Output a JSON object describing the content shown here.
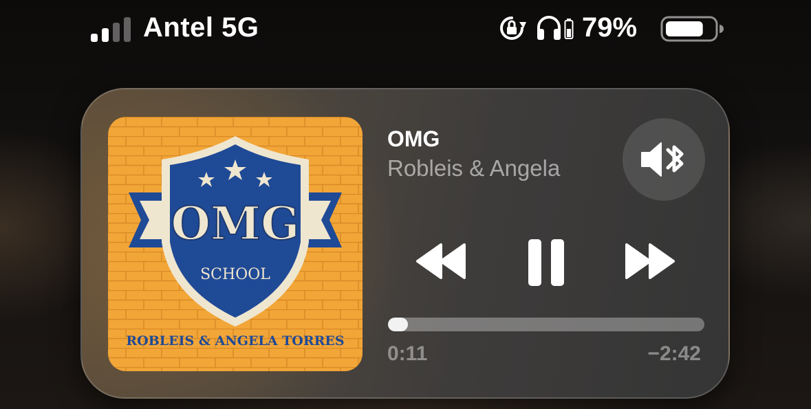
{
  "status_bar": {
    "carrier": "Antel 5G",
    "signal_bars_active": 2,
    "signal_bars_total": 4,
    "battery_percent_label": "79%",
    "battery_level": 0.79,
    "icons": [
      "signal-icon",
      "rotation-lock-icon",
      "headphones-icon",
      "headphones-battery-icon",
      "battery-icon"
    ]
  },
  "now_playing": {
    "title": "OMG",
    "artist": "Robleis & Angela",
    "artwork": {
      "logo_text": "OMG",
      "school_text": "SCHOOL",
      "footer_text": "ROBLEIS & ANGELA TORRES"
    },
    "output_icon": "speaker-bluetooth-icon",
    "controls": {
      "rewind": "rewind-icon",
      "pause": "pause-icon",
      "fast_forward": "fast-forward-icon"
    },
    "elapsed": "0:11",
    "remaining": "−2:42",
    "progress": 0.064
  },
  "colors": {
    "brick_orange": "#f2a638",
    "shield_blue": "#1f4a96",
    "cream": "#efe6cf",
    "track": "rgba(255,255,255,0.32)",
    "fill": "#f2f2f2"
  }
}
